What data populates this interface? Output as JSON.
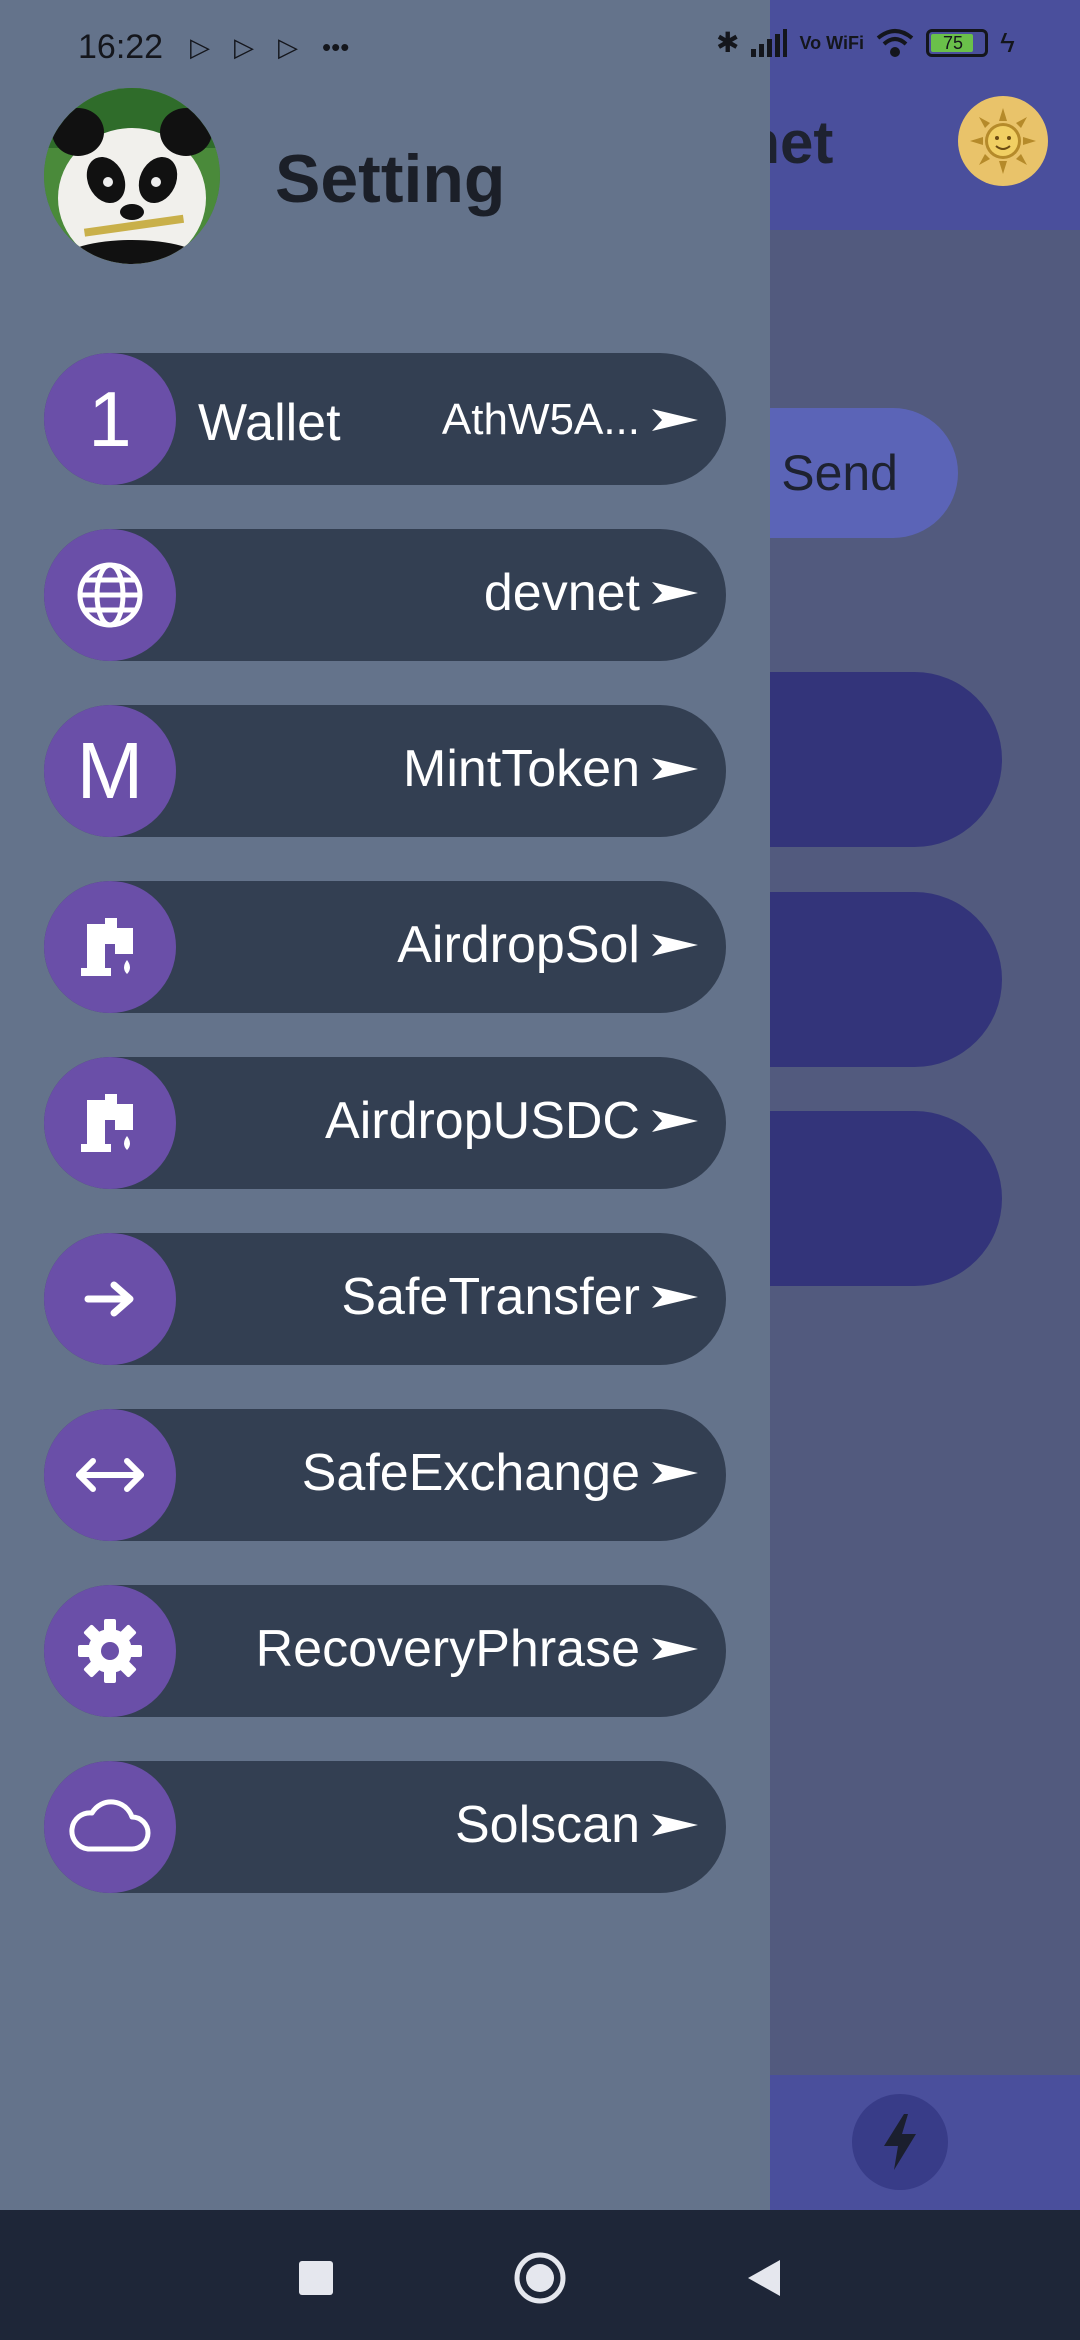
{
  "status_bar": {
    "time": "16:22",
    "battery": "75",
    "network_label": "Vo WiFi"
  },
  "background_app": {
    "title": "devnet",
    "send_label": "Send"
  },
  "drawer": {
    "title": "Setting",
    "items": [
      {
        "icon_text": "1",
        "left_label": "Wallet",
        "right_label": "AthW5A...",
        "icon": "number-one-icon"
      },
      {
        "right_label": "devnet",
        "icon": "globe-icon"
      },
      {
        "icon_text": "M",
        "right_label": "MintToken",
        "icon": "letter-m-icon"
      },
      {
        "right_label": "AirdropSol",
        "icon": "faucet-icon"
      },
      {
        "right_label": "AirdropUSDC",
        "icon": "faucet-icon"
      },
      {
        "right_label": "SafeTransfer",
        "icon": "arrow-right-icon"
      },
      {
        "right_label": "SafeExchange",
        "icon": "arrow-left-right-icon"
      },
      {
        "right_label": "RecoveryPhrase",
        "icon": "gear-icon"
      },
      {
        "right_label": "Solscan",
        "icon": "cloud-icon"
      }
    ]
  },
  "colors": {
    "drawer_bg": "#64738b",
    "item_bg": "#333f52",
    "icon_circle": "#6a4fa8",
    "header_bg": "#4a4f9c",
    "navbar_bg": "#1e2638"
  }
}
